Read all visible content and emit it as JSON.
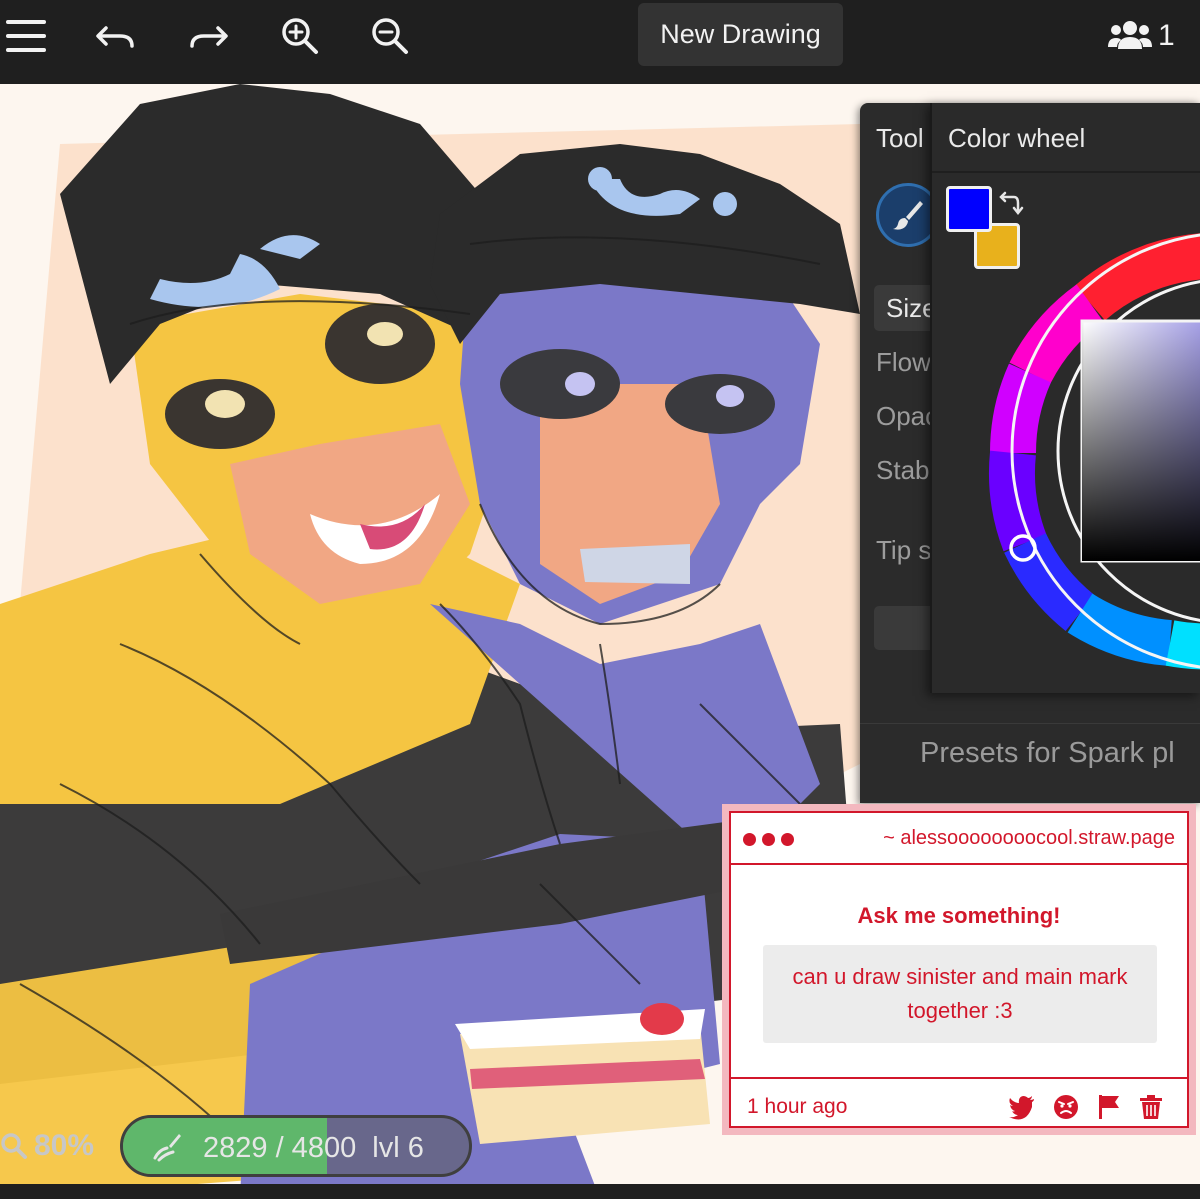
{
  "toolbar": {
    "icons": [
      "menu-icon",
      "undo-icon",
      "redo-icon",
      "zoom-in-icon",
      "zoom-out-icon"
    ],
    "new_drawing_label": "New Drawing",
    "users_count": "1"
  },
  "tool_panel": {
    "title": "Tool",
    "size_label": "Size",
    "flow_label": "Flow",
    "opacity_label": "Opac",
    "stabilizer_label": "Stab",
    "tip_label": "Tip s",
    "presets_label": "Presets for Spark pl",
    "active_tool_icon": "brush-icon"
  },
  "color_panel": {
    "title": "Color wheel",
    "primary_color": "#0000ff",
    "secondary_color": "#e8b11c"
  },
  "ask_box": {
    "url": "~ alessoooooooocool.straw.page",
    "title": "Ask me something!",
    "question": "can u draw sinister and main mark together :3",
    "time": "1 hour ago",
    "accent": "#d2172b",
    "action_icons": [
      "twitter-icon",
      "angry-face-icon",
      "flag-icon",
      "trash-icon"
    ]
  },
  "status": {
    "zoom": "80%",
    "xp_text": "2829 / 4800",
    "level_text": "lvl 6",
    "xp_fraction": 0.589
  }
}
